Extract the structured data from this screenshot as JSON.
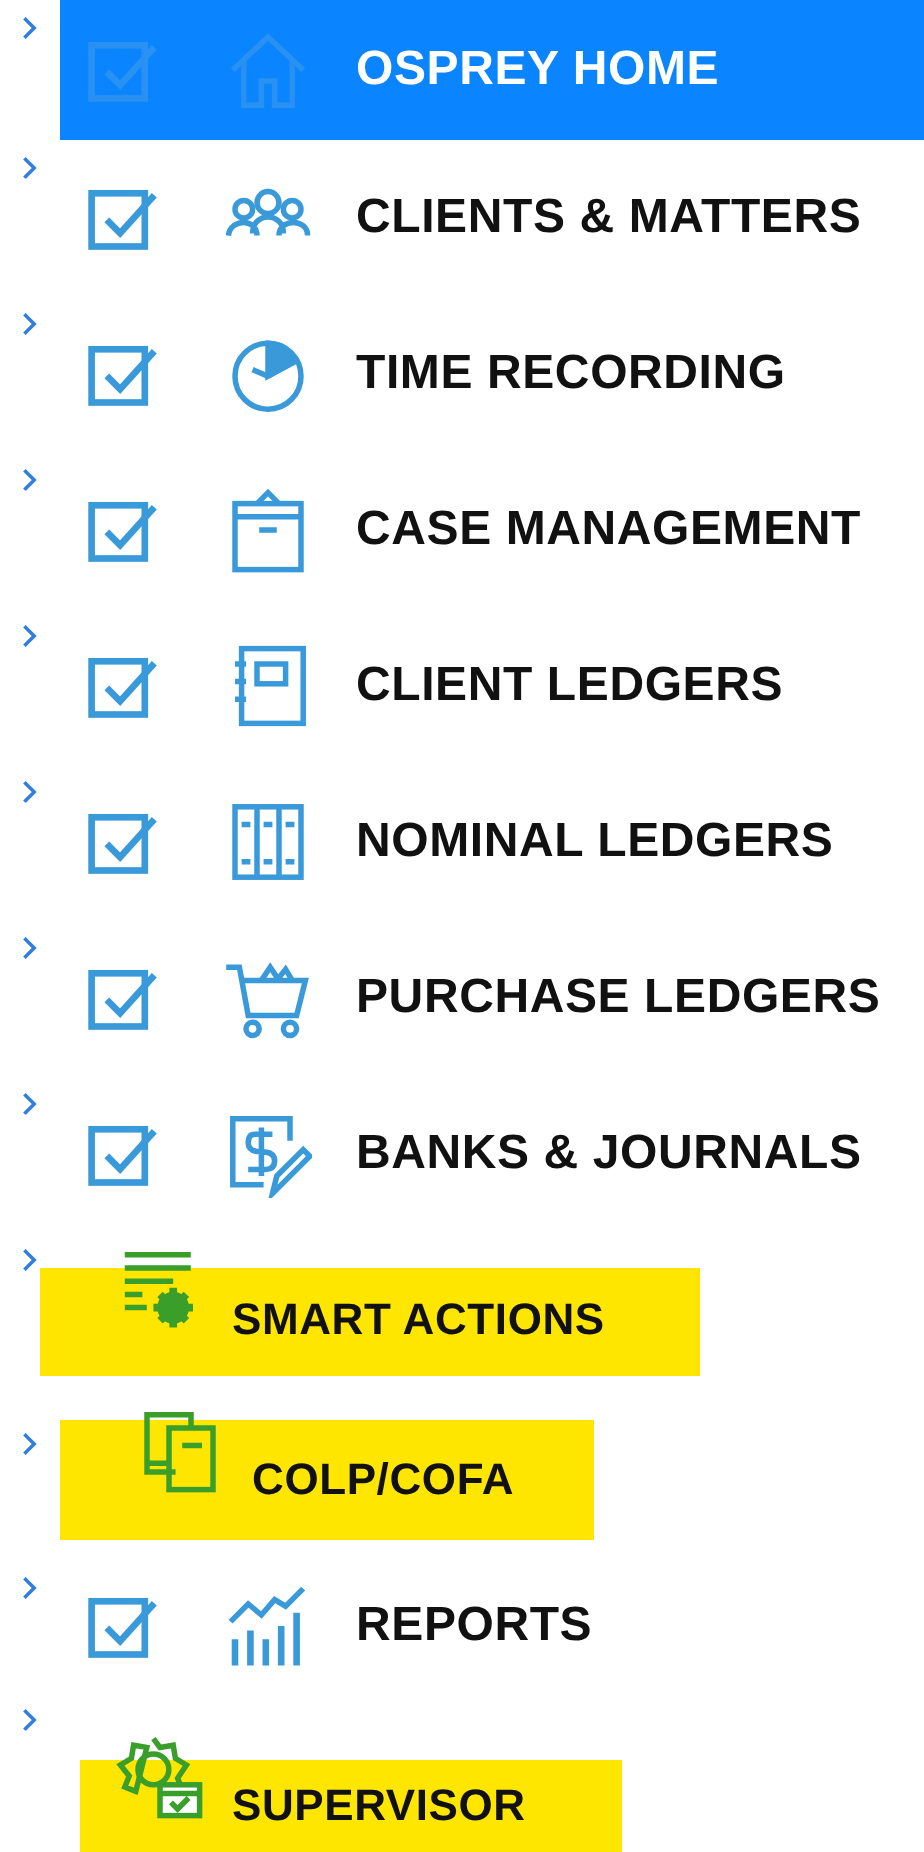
{
  "nav_items": [
    {
      "label": "OSPREY HOME",
      "kind": "checkbox",
      "checked": true,
      "selected": true,
      "highlighted": false
    },
    {
      "label": "CLIENTS & MATTERS",
      "kind": "checkbox",
      "checked": true,
      "selected": false,
      "highlighted": false
    },
    {
      "label": "TIME RECORDING",
      "kind": "checkbox",
      "checked": true,
      "selected": false,
      "highlighted": false
    },
    {
      "label": "CASE MANAGEMENT",
      "kind": "checkbox",
      "checked": true,
      "selected": false,
      "highlighted": false
    },
    {
      "label": "CLIENT LEDGERS",
      "kind": "checkbox",
      "checked": true,
      "selected": false,
      "highlighted": false
    },
    {
      "label": "NOMINAL LEDGERS",
      "kind": "checkbox",
      "checked": true,
      "selected": false,
      "highlighted": false
    },
    {
      "label": "PURCHASE LEDGERS",
      "kind": "checkbox",
      "checked": true,
      "selected": false,
      "highlighted": false
    },
    {
      "label": "BANKS & JOURNALS",
      "kind": "checkbox",
      "checked": true,
      "selected": false,
      "highlighted": false
    },
    {
      "label": "SMART ACTIONS",
      "kind": "plain",
      "selected": false,
      "highlighted": true
    },
    {
      "label": "COLP/COFA",
      "kind": "plain",
      "selected": false,
      "highlighted": true
    },
    {
      "label": "REPORTS",
      "kind": "checkbox",
      "checked": true,
      "selected": false,
      "highlighted": false
    },
    {
      "label": "SUPERVISOR",
      "kind": "plain",
      "selected": false,
      "highlighted": true
    }
  ]
}
